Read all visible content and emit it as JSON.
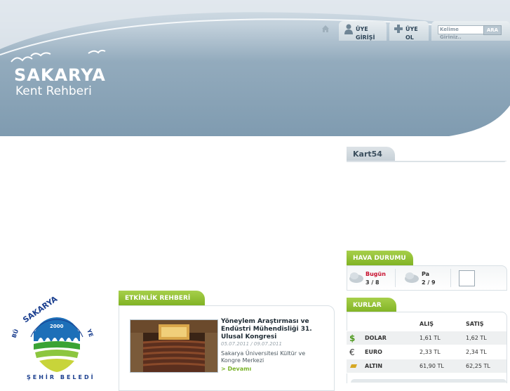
{
  "header": {
    "logo_line1": "SAKARYA",
    "logo_line2": "Kent Rehberi",
    "nav": {
      "login_label": "ÜYE GİRİŞİ",
      "register_label": "ÜYE OL",
      "search_placeholder": "Kelime Giriniz..",
      "search_button": "ARA"
    }
  },
  "kart": {
    "title": "Kart54"
  },
  "weather": {
    "title": "HAVA DURUMU",
    "days": [
      {
        "label": "Bugün",
        "temps": "3 / 8",
        "label_color": "#c8102e"
      },
      {
        "label": "Pa",
        "temps": "2 / 9",
        "label_color": "#333333"
      }
    ]
  },
  "currency": {
    "title": "KURLAR",
    "headers": [
      "",
      "",
      "ALIŞ",
      "SATIŞ"
    ],
    "rows": [
      {
        "icon": "dollar-icon",
        "name": "DOLAR",
        "buy": "1,61 TL",
        "sell": "1,62 TL"
      },
      {
        "icon": "euro-icon",
        "name": "EURO",
        "buy": "2,33 TL",
        "sell": "2,34 TL"
      },
      {
        "icon": "gold-icon",
        "name": "ALTIN",
        "buy": "61,90 TL",
        "sell": "62,25 TL"
      }
    ]
  },
  "events": {
    "title": "ETKİNLİK REHBERİ",
    "item": {
      "title": "Yöneylem Araştırması ve Endüstri Mühendisliği 31. Ulusal Kongresi",
      "dates": "05.07.2011 / 09.07.2011",
      "place": "Sakarya Üniversitesi Kültür ve Kongre Merkezi",
      "more": "> Devamı"
    }
  },
  "seal": {
    "top_text": "SAKARYA",
    "year": "2000",
    "ring_text": "BÜYÜKŞEHİR BELEDİYESİ"
  },
  "colors": {
    "accent_green": "#7fb223",
    "header_blue": "#7f9bb0",
    "alert_red": "#c8102e"
  }
}
